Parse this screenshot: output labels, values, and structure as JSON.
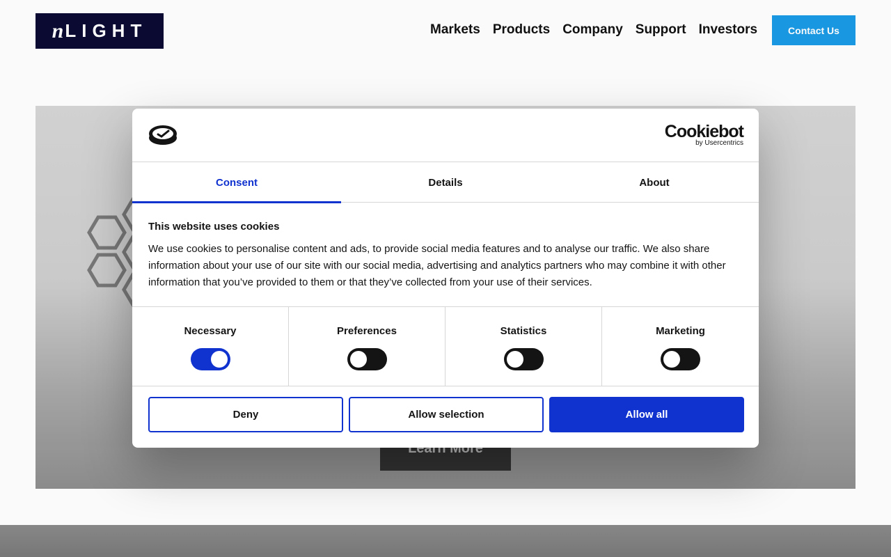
{
  "header": {
    "logo_text": "nLIGHT",
    "nav": [
      "Markets",
      "Products",
      "Company",
      "Support",
      "Investors"
    ],
    "contact_label": "Contact Us"
  },
  "hero": {
    "button_label": "Learn More"
  },
  "dialog": {
    "brand": {
      "name": "Cookiebot",
      "byline": "by Usercentrics"
    },
    "tabs": [
      "Consent",
      "Details",
      "About"
    ],
    "active_tab": "Consent",
    "title": "This website uses cookies",
    "body": "We use cookies to personalise content and ads, to provide social media features and to analyse our traffic. We also share information about your use of our site with our social media, advertising and analytics partners who may combine it with other information that you’ve provided to them or that they’ve collected from your use of their services.",
    "categories": [
      {
        "label": "Necessary",
        "enabled": true
      },
      {
        "label": "Preferences",
        "enabled": false
      },
      {
        "label": "Statistics",
        "enabled": false
      },
      {
        "label": "Marketing",
        "enabled": false
      }
    ],
    "buttons": {
      "deny": "Deny",
      "allow_selection": "Allow selection",
      "allow_all": "Allow all"
    }
  },
  "colors": {
    "accent": "#1032cf",
    "contact": "#1b9be6",
    "logo_bg": "#0b0b33"
  }
}
